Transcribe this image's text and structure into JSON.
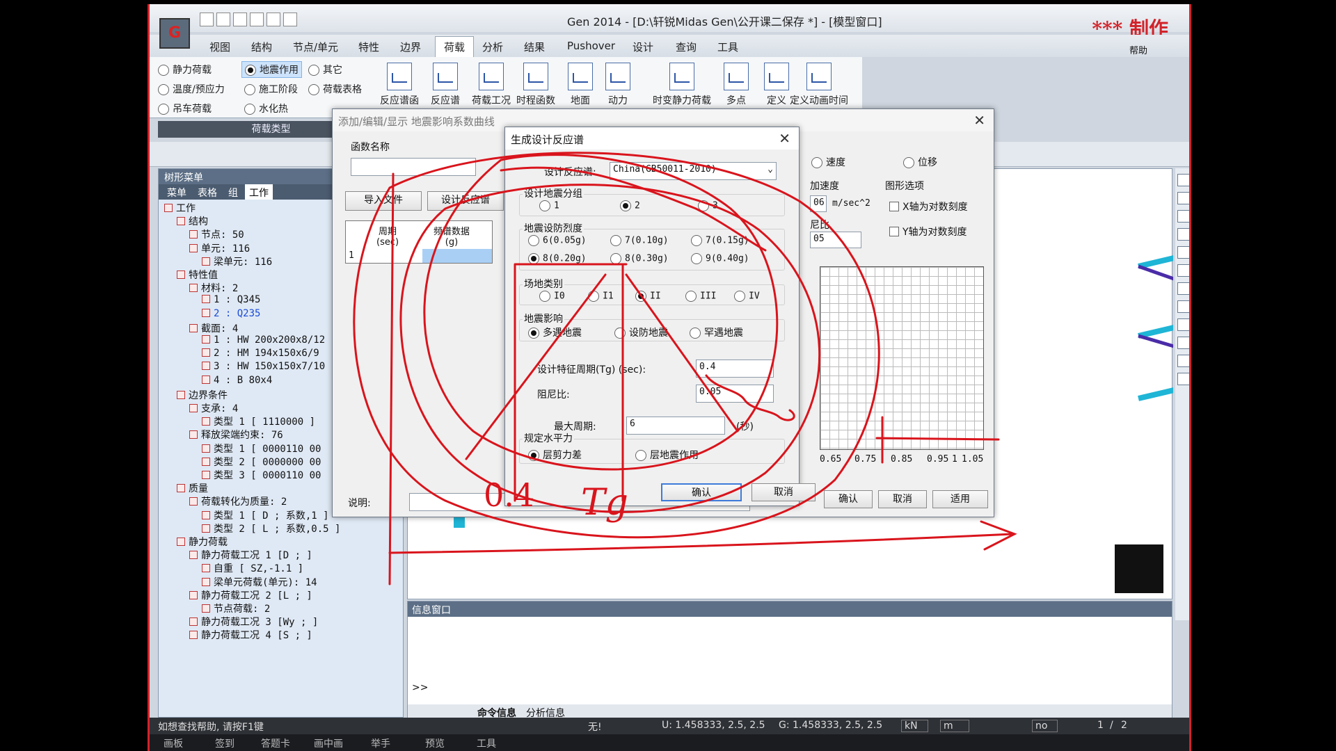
{
  "app": {
    "title": "Gen 2014 - [D:\\轩锐Midas Gen\\公开课二保存 *] - [模型窗口]",
    "watermark": "*** 制作",
    "help": "帮助",
    "logo": "G"
  },
  "ribbon_tabs": [
    "视图",
    "结构",
    "节点/单元",
    "特性",
    "边界",
    "荷载",
    "分析",
    "结果",
    "Pushover",
    "设计",
    "查询",
    "工具"
  ],
  "active_tab_index": 5,
  "load_types": {
    "options": [
      {
        "label": "静力荷载",
        "selected": false
      },
      {
        "label": "地震作用",
        "selected": true
      },
      {
        "label": "其它",
        "selected": false
      },
      {
        "label": "温度/预应力",
        "selected": false
      },
      {
        "label": "施工阶段",
        "selected": false
      },
      {
        "label": "荷载表格",
        "selected": false
      },
      {
        "label": "吊车荷载",
        "selected": false
      },
      {
        "label": "水化热",
        "selected": false
      }
    ],
    "group_label": "荷载类型"
  },
  "ribbon_buttons": [
    "反应谱函数",
    "反应谱",
    "荷载工况",
    "时程函数",
    "地面",
    "动力",
    "时变静力荷载",
    "多点",
    "定义",
    "定义动画时间"
  ],
  "tree": {
    "header": "树形菜单",
    "tabs": [
      "菜单",
      "表格",
      "组",
      "工作"
    ],
    "active_tab": 3,
    "nodes": [
      {
        "text": "工作",
        "level": 0
      },
      {
        "text": "结构",
        "level": 1
      },
      {
        "text": "节点: 50",
        "level": 2
      },
      {
        "text": "单元: 116",
        "level": 2
      },
      {
        "text": "梁单元: 116",
        "level": 3
      },
      {
        "text": "特性值",
        "level": 1
      },
      {
        "text": "材料: 2",
        "level": 2
      },
      {
        "text": "1 : Q345",
        "level": 3
      },
      {
        "text": "2 : Q235",
        "level": 3,
        "highlight": true
      },
      {
        "text": "截面: 4",
        "level": 2
      },
      {
        "text": "1 : HW 200x200x8/12",
        "level": 3
      },
      {
        "text": "2 : HM 194x150x6/9",
        "level": 3
      },
      {
        "text": "3 : HW 150x150x7/10",
        "level": 3
      },
      {
        "text": "4 : B 80x4",
        "level": 3
      },
      {
        "text": "边界条件",
        "level": 1
      },
      {
        "text": "支承: 4",
        "level": 2
      },
      {
        "text": "类型 1 [ 1110000 ]",
        "level": 3
      },
      {
        "text": "释放梁端约束: 76",
        "level": 2
      },
      {
        "text": "类型 1 [ 0000110 00",
        "level": 3
      },
      {
        "text": "类型 2 [ 0000000 00",
        "level": 3
      },
      {
        "text": "类型 3 [ 0000110 00",
        "level": 3
      },
      {
        "text": "质量",
        "level": 1
      },
      {
        "text": "荷载转化为质量: 2",
        "level": 2
      },
      {
        "text": "类型 1 [ D ; 系数,1 ]",
        "level": 3
      },
      {
        "text": "类型 2 [ L ; 系数,0.5 ]",
        "level": 3
      },
      {
        "text": "静力荷载",
        "level": 1
      },
      {
        "text": "静力荷载工况 1 [D ; ]",
        "level": 2
      },
      {
        "text": "自重 [ SZ,-1.1 ]",
        "level": 3
      },
      {
        "text": "梁单元荷载(单元): 14",
        "level": 3
      },
      {
        "text": "静力荷载工况 2 [L ; ]",
        "level": 2
      },
      {
        "text": "节点荷载: 2",
        "level": 3
      },
      {
        "text": "静力荷载工况 3 [Wy ; ]",
        "level": 2
      },
      {
        "text": "静力荷载工况 4 [S ; ]",
        "level": 2
      }
    ]
  },
  "bg_dialog": {
    "title": "添加/编辑/显示 地震影响系数曲线",
    "func_name_label": "函数名称",
    "import_btn": "导入文件",
    "design_btn": "设计反应谱",
    "table_headers": [
      "周期\n(sec)",
      "频谱数据\n(g)"
    ],
    "row_num": "1",
    "desc_label": "说明:",
    "speed_label": "速度",
    "disp_label": "位移",
    "accel_label": "加速度",
    "accel_val": "06",
    "accel_unit": "m/sec^2",
    "ratio_label": "尼比",
    "ratio_val": "05",
    "graph_opts_label": "图形选项",
    "x_log": "X轴为对数刻度",
    "y_log": "Y轴为对数刻度",
    "x_ticks": [
      "0.65",
      "0.75",
      "0.85",
      "0.95",
      "1",
      "1.05"
    ],
    "ok": "确认",
    "cancel": "取消",
    "apply": "适用"
  },
  "fg_dialog": {
    "title": "生成设计反应谱",
    "spectrum_label": "设计反应谱:",
    "spectrum_value": "China(GB50011-2010)",
    "group_label": "设计地震分组",
    "group_options": [
      {
        "label": "1",
        "on": false
      },
      {
        "label": "2",
        "on": true
      },
      {
        "label": "3",
        "on": false
      }
    ],
    "intensity_label": "地震设防烈度",
    "intensity_options": [
      {
        "label": "6(0.05g)",
        "on": false
      },
      {
        "label": "7(0.10g)",
        "on": false
      },
      {
        "label": "7(0.15g)",
        "on": false
      },
      {
        "label": "8(0.20g)",
        "on": true
      },
      {
        "label": "8(0.30g)",
        "on": false
      },
      {
        "label": "9(0.40g)",
        "on": false
      }
    ],
    "site_label": "场地类别",
    "site_options": [
      {
        "label": "I0",
        "on": false
      },
      {
        "label": "I1",
        "on": false
      },
      {
        "label": "II",
        "on": true
      },
      {
        "label": "III",
        "on": false
      },
      {
        "label": "IV",
        "on": false
      }
    ],
    "effect_label": "地震影响",
    "effect_options": [
      {
        "label": "多遇地震",
        "on": true
      },
      {
        "label": "设防地震",
        "on": false
      },
      {
        "label": "罕遇地震",
        "on": false
      }
    ],
    "tg_label": "设计特征周期(Tg) (sec):",
    "tg_value": "0.4",
    "damp_label": "阻尼比:",
    "damp_value": "0.05",
    "maxp_label": "最大周期:",
    "maxp_value": "6",
    "maxp_unit": "(秒)",
    "horiz_label": "规定水平力",
    "horiz_options": [
      {
        "label": "层剪力差",
        "on": true
      },
      {
        "label": "层地震作用",
        "on": false
      }
    ],
    "ok": "确认",
    "cancel": "取消"
  },
  "info_window": {
    "title": "信息窗口",
    "prompt": ">>",
    "tabs": [
      "命令信息",
      "分析信息"
    ]
  },
  "status_bar": {
    "help": "如想查找帮助, 请按F1键",
    "none": "无!",
    "u": "U: 1.458333, 2.5, 2.5",
    "g": "G: 1.458333, 2.5, 2.5",
    "unit_force": "kN",
    "unit_len": "m",
    "mode": "no",
    "page": "1",
    "pages": "2"
  },
  "taskbar": [
    "画板",
    "签到",
    "答题卡",
    "画中画",
    "举手",
    "预览",
    "工具"
  ],
  "annotations": [
    "0.4",
    "Tg"
  ]
}
